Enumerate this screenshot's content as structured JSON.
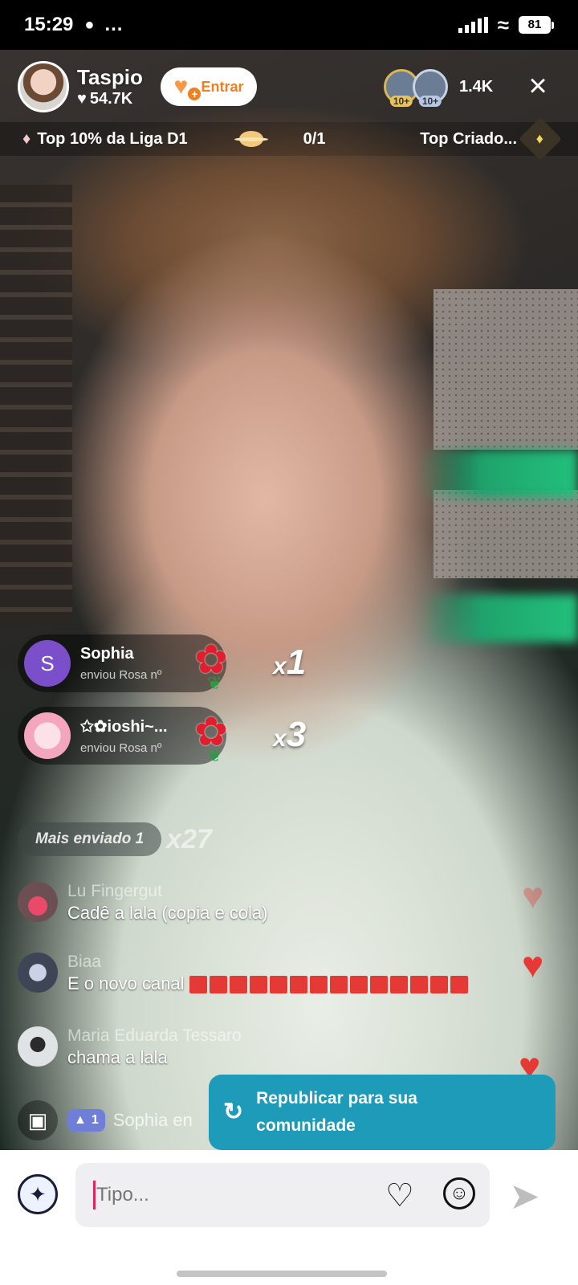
{
  "status_bar": {
    "time": "15:29",
    "notification_icons": "…",
    "battery": "81"
  },
  "host": {
    "name": "Taspio",
    "likes": "54.7K",
    "follow_label": "Entrar"
  },
  "viewers": {
    "badge1": "10+",
    "badge2": "10+",
    "count": "1.4K"
  },
  "league": {
    "rank_text": "Top 10% da Liga D1",
    "progress": "0/1",
    "top_creators": "Top Criado..."
  },
  "gifts": [
    {
      "user": "Sophia",
      "avatar_letter": "S",
      "avatar_color": "#7b4fc9",
      "sub": "enviou Rosa nº",
      "gift_icon": "rose-icon",
      "combo_prefix": "x",
      "combo": "1"
    },
    {
      "user": "✩✿ioshi~...",
      "avatar_letter": "",
      "avatar_color": "#f3c3cf",
      "sub": "enviou Rosa nº",
      "gift_icon": "rose-icon",
      "combo_prefix": "x",
      "combo": "3"
    }
  ],
  "most_sent": {
    "label": "Mais enviado 1",
    "count": "x27"
  },
  "chat": [
    {
      "user": "Lu Fingergut",
      "message": "Cadê a lala (copia e cola)"
    },
    {
      "user": "Biaa",
      "message": "E o novo canal"
    },
    {
      "user": "Maria Eduarda Tessaro",
      "message": "chama a lala"
    }
  ],
  "mini_row": {
    "level": "1",
    "name": "Sophia en"
  },
  "repost": {
    "line1": "Republicar para sua",
    "line2": "comunidade"
  },
  "input": {
    "placeholder": "Tipo..."
  },
  "colors": {
    "accent_orange": "#ef7f1f",
    "repost_blue": "#1e9bb8",
    "heart_red": "#e53935"
  }
}
